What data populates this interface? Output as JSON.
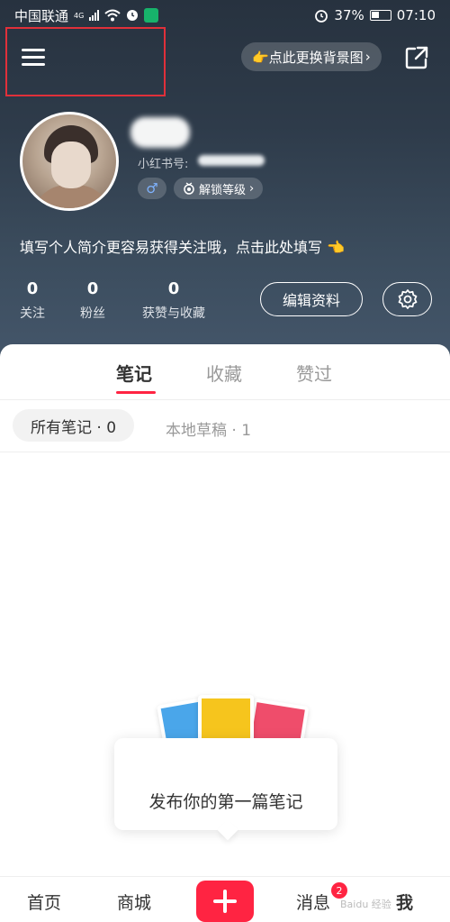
{
  "status_bar": {
    "carrier": "中国联通",
    "network": "4G",
    "battery": "37%",
    "time": "07:10"
  },
  "header": {
    "bg_change_label": "👉点此更换背景图",
    "bg_change_chevron": "›"
  },
  "profile": {
    "rednote_id_label": "小红书号:",
    "gender_symbol": "♂",
    "level_label": "解锁等级",
    "level_chevron": "›",
    "bio": "填写个人简介更容易获得关注哦，点击此处填写 👈",
    "stats": [
      {
        "value": "0",
        "label": "关注"
      },
      {
        "value": "0",
        "label": "粉丝"
      },
      {
        "value": "0",
        "label": "获赞与收藏"
      }
    ],
    "edit_button_label": "编辑资料"
  },
  "tabs": [
    {
      "label": "笔记",
      "active": true
    },
    {
      "label": "收藏",
      "active": false
    },
    {
      "label": "赞过",
      "active": false
    }
  ],
  "subtabs": {
    "all_notes": "所有笔记 · 0",
    "drafts": "本地草稿 · 1"
  },
  "empty_state": {
    "text": "发布你的第一篇笔记"
  },
  "bottom_nav": {
    "home": "首页",
    "mall": "商城",
    "messages": "消息",
    "messages_badge": "2",
    "me": "我"
  },
  "watermark": "Baidu 经验",
  "colors": {
    "accent": "#ff2442",
    "header_top": "#27323f",
    "header_bottom": "#44566a"
  }
}
